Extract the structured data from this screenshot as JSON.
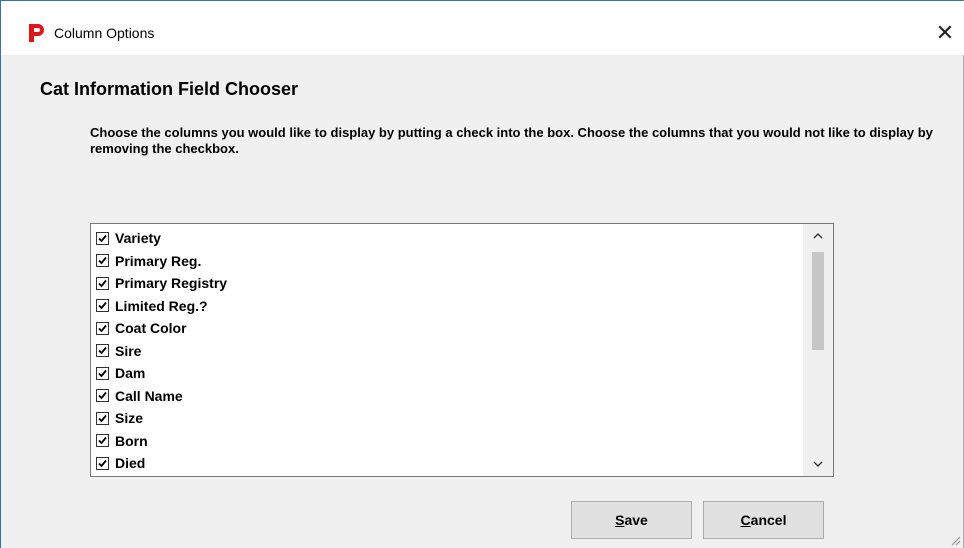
{
  "window": {
    "title": "Column Options",
    "app_icon": "red-p-logo-icon",
    "close_glyph": "✕"
  },
  "heading": "Cat Information Field Chooser",
  "instructions": "Choose the columns you would like to display by putting a check into the box.  Choose the columns that you would not like to display by removing the checkbox.",
  "fields": [
    {
      "label": "Variety",
      "checked": true
    },
    {
      "label": "Primary Reg.",
      "checked": true
    },
    {
      "label": "Primary Registry",
      "checked": true
    },
    {
      "label": "Limited Reg.?",
      "checked": true
    },
    {
      "label": "Coat Color",
      "checked": true
    },
    {
      "label": "Sire",
      "checked": true
    },
    {
      "label": "Dam",
      "checked": true
    },
    {
      "label": "Call Name",
      "checked": true
    },
    {
      "label": "Size",
      "checked": true
    },
    {
      "label": "Born",
      "checked": true
    },
    {
      "label": "Died",
      "checked": true
    }
  ],
  "buttons": {
    "save": {
      "mnemonic": "S",
      "rest": "ave"
    },
    "cancel": {
      "mnemonic": "C",
      "rest": "ancel"
    }
  },
  "colors": {
    "accent": "#3a6fb0",
    "icon_red": "#e0141b"
  }
}
